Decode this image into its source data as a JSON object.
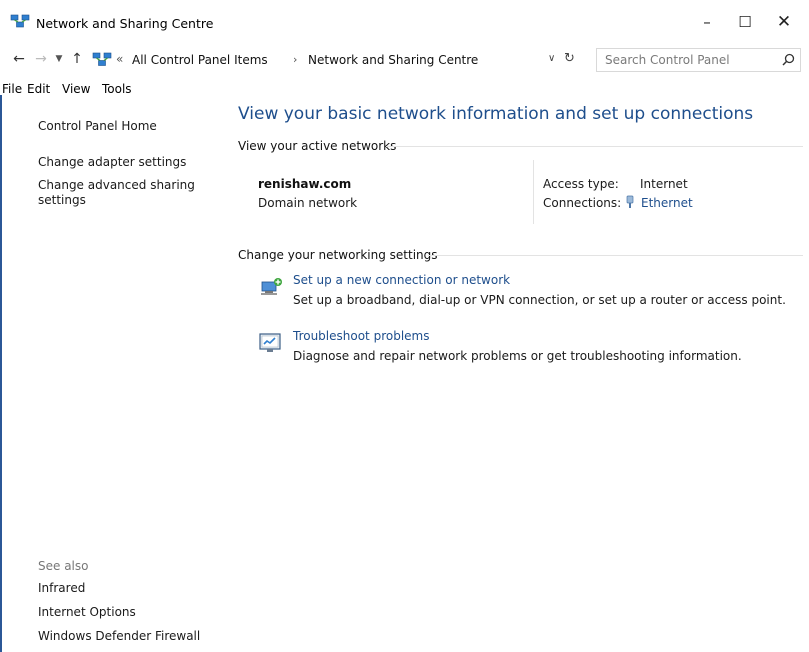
{
  "window": {
    "title": "Network and Sharing Centre",
    "controls": {
      "minimize": "–",
      "maximize": "☐",
      "close": "✕"
    }
  },
  "address_bar": {
    "prefix": "«",
    "crumbs": [
      "All Control Panel Items",
      "Network and Sharing Centre"
    ],
    "separator": "›",
    "search_placeholder": "Search Control Panel"
  },
  "menu": [
    "File",
    "Edit",
    "View",
    "Tools"
  ],
  "left_nav": {
    "items": [
      "Control Panel Home",
      "Change adapter settings",
      "Change advanced sharing",
      "settings"
    ],
    "see_also_label": "See also",
    "see_also": [
      "Infrared",
      "Internet Options",
      "Windows Defender Firewall"
    ]
  },
  "main": {
    "title": "View your basic network information and set up connections",
    "active_networks_heading": "View your active networks",
    "network": {
      "name": "renishaw.com",
      "type": "Domain network",
      "access_type_label": "Access type:",
      "access_type_value": "Internet",
      "connections_label": "Connections:",
      "connections_value": "Ethernet"
    },
    "settings_heading": "Change your networking settings",
    "tasks": [
      {
        "title": "Set up a new connection or network",
        "description": "Set up a broadband, dial-up or VPN connection, or set up a router or access point.",
        "icon": "new-connection-icon"
      },
      {
        "title": "Troubleshoot problems",
        "description": "Diagnose and repair network problems or get troubleshooting information.",
        "icon": "troubleshoot-icon"
      }
    ]
  },
  "colors": {
    "link": "#1e4e8c",
    "title": "#1e4e8c",
    "edge": "#2b5797"
  }
}
